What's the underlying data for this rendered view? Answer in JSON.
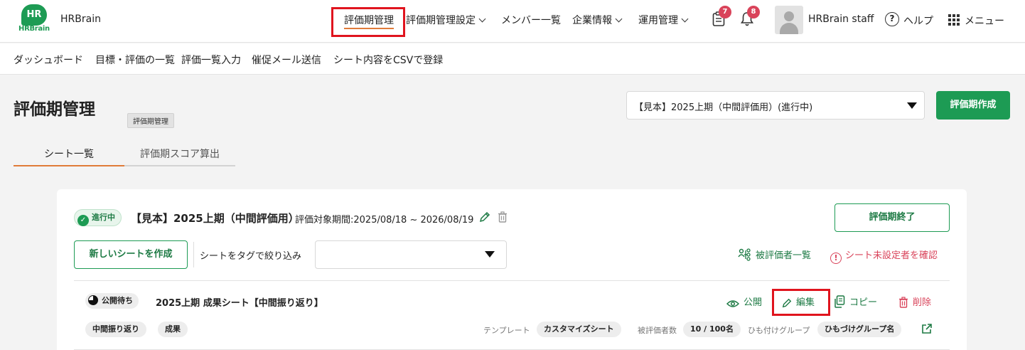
{
  "header": {
    "logo_mark": "HR",
    "logo_text": "HRBrain",
    "app_name": "HRBrain",
    "nav": [
      {
        "label": "評価期管理",
        "active": true
      },
      {
        "label": "評価期管理設定"
      },
      {
        "label": "メンバー一覧"
      },
      {
        "label": "企業情報"
      },
      {
        "label": "運用管理"
      }
    ],
    "notifications": {
      "tasks_count": "7",
      "bell_count": "8"
    },
    "user_name": "HRBrain staff",
    "help_label": "ヘルプ",
    "menu_label": "メニュー"
  },
  "subnav": [
    "ダッシュボード",
    "目標・評価の一覧",
    "評価一覧入力",
    "催促メール送信",
    "シート内容をCSVで登録"
  ],
  "page": {
    "title": "評価期管理",
    "tooltip": "評価期管理",
    "period_select_value": "【見本】2025上期（中間評価用）(進行中)",
    "create_button": "評価期作成",
    "tabs": [
      {
        "label": "シート一覧",
        "active": true
      },
      {
        "label": "評価期スコア算出"
      }
    ]
  },
  "period_card": {
    "status": "進行中",
    "title": "【見本】2025上期（中間評価用）",
    "range": "評価対象期間:2025/08/18 ~ 2026/08/19",
    "end_button": "評価期終了",
    "new_sheet_button": "新しいシートを作成",
    "filter_label": "シートをタグで絞り込み",
    "evaluatees_link": "被評価者一覧",
    "unassigned_link": "シート未設定者を確認"
  },
  "sheet": {
    "status": "公開待ち",
    "title": "2025上期 成果シート【中間振り返り】",
    "actions": {
      "publish": "公開",
      "edit": "編集",
      "copy": "コピー",
      "delete": "削除"
    },
    "tags": [
      "中間振り返り",
      "成果"
    ],
    "template_label": "テンプレート",
    "template_value": "カスタマイズシート",
    "evaluatee_count_label": "被評価者数",
    "evaluatee_count_value": "10 / 100名",
    "group_label": "ひも付けグループ",
    "group_value": "ひもづけグループ名"
  },
  "colors": {
    "brand": "#1d9b54",
    "accent_underline": "#e07b39",
    "danger": "#d9435a",
    "highlight": "#e0141e"
  }
}
